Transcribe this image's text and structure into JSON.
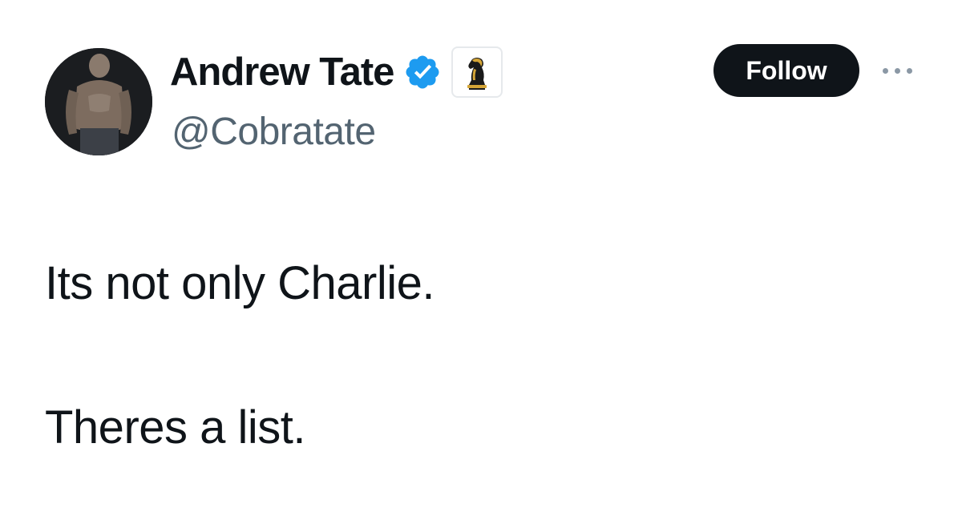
{
  "author": {
    "display_name": "Andrew Tate",
    "handle": "@Cobratate",
    "verified": true,
    "avatar_icon": "profile-photo",
    "affiliate_badge_icon": "chess-knight-icon"
  },
  "actions": {
    "follow_label": "Follow",
    "more_icon": "more-horizontal-icon"
  },
  "tweet": {
    "lines": [
      "Its not only Charlie.",
      "Theres a list."
    ]
  },
  "colors": {
    "text_primary": "#0f1419",
    "text_secondary": "#536471",
    "verified_blue": "#1d9bf0",
    "follow_bg": "#0f1419",
    "background": "#ffffff"
  }
}
